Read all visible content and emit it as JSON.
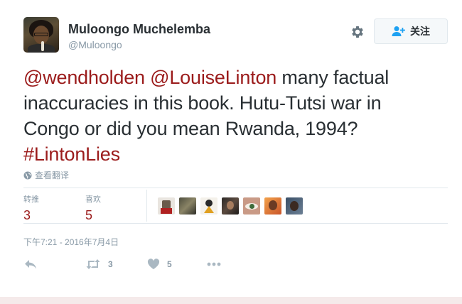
{
  "user": {
    "display_name": "Muloongo Muchelemba",
    "handle": "@Muloongo"
  },
  "follow_button": {
    "label": "关注",
    "icon": "add-user-icon"
  },
  "settings_icon": "gear-icon",
  "tweet": {
    "mention_1": "@wendholden",
    "mention_2": "@LouiseLinton",
    "text_part_1": " many factual inaccuracies in this book. Hutu-Tutsi war in Congo or did you mean Rwanda, 1994? ",
    "hashtag": "#LintonLies"
  },
  "translate": {
    "label": "查看翻译",
    "icon": "globe-icon"
  },
  "stats": {
    "retweets_label": "转推",
    "retweets_count": "3",
    "likes_label": "喜欢",
    "likes_count": "5"
  },
  "likers_count": 7,
  "timestamp": "下午7:21 - 2016年7月4日",
  "actions": {
    "reply_icon": "reply-icon",
    "retweet_icon": "retweet-icon",
    "retweet_count": "3",
    "like_icon": "heart-icon",
    "like_count": "5",
    "more_icon": "more-dots-icon"
  },
  "colors": {
    "link": "#9b1b1b",
    "muted": "#8899a6",
    "text": "#292f33",
    "border": "#e1e8ed"
  }
}
